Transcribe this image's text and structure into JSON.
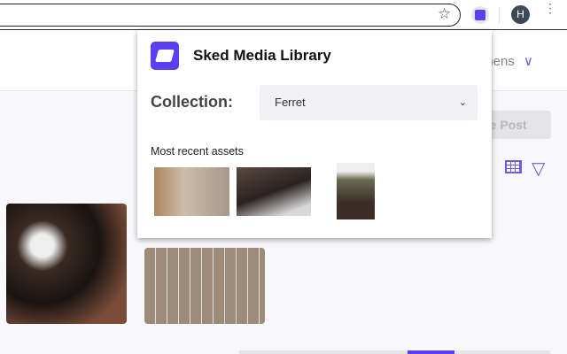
{
  "browser": {
    "avatar_initial": "H",
    "star_icon": "☆",
    "menu_icon": "⋮"
  },
  "app": {
    "user_name_partial": "phens",
    "create_post_partial": "te Post"
  },
  "popup": {
    "title": "Sked Media Library",
    "collection_label": "Collection:",
    "collection_value": "Ferret",
    "recent_label": "Most recent assets"
  },
  "colors": {
    "accent": "#5b3ff0"
  }
}
